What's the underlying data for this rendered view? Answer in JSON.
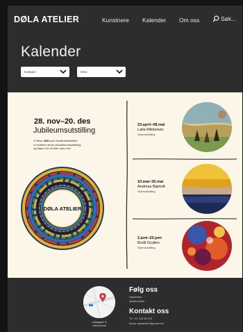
{
  "header": {
    "logo": "DØLA ATELIER",
    "nav": [
      "Kunstnere",
      "Kalender",
      "Om oss"
    ],
    "search_label": "Søk..."
  },
  "page": {
    "title": "Kalender",
    "filters": [
      {
        "label": "Kategori"
      },
      {
        "label": "Dato"
      }
    ]
  },
  "featured": {
    "date": "28. nov–20. des",
    "name": "Jubileumsutstilling",
    "desc_line1_pre": "Vi feirer ",
    "desc_line1_bold": "20år",
    "desc_line1_post": " som kunstnerkollektiv!",
    "desc_line2": "Vi inviterer derfor på jubileumsutstilling,",
    "desc_line3": "og håper DU vil feire med oss!",
    "circle_text": "DØLA ATELIER"
  },
  "events": [
    {
      "date": "23.april–08.mai",
      "artist": "Laila Mikkelsen",
      "venue": "Sejerstutstilling"
    },
    {
      "date": "10.mai–30.mai",
      "artist": "Andreas Bjørtuft",
      "venue": "Sejerstutstilling"
    },
    {
      "date": "2.juni–20.juni",
      "artist": "Bodil Grytten",
      "venue": "Sejerstutstilling"
    }
  ],
  "footer": {
    "address_line1": "Lalleggata 5,",
    "address_line2": "Lillehammer",
    "follow_heading": "Følg oss",
    "follow_line1": "DølaAtelier",
    "follow_line2": "@døla.atelier",
    "contact_heading": "Kontakt oss",
    "contact_line1": "Tlf: +47 123 45 678",
    "contact_line2": "Epost: dølaatelier@gmail.com"
  },
  "colors": {
    "dark_bg": "#2d2d2d",
    "content_bg": "#fcf6e8",
    "map_pin": "#d23a3a"
  }
}
